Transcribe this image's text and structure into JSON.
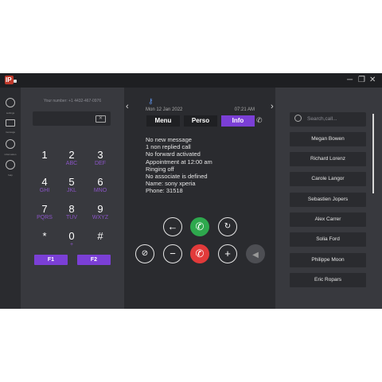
{
  "app": {
    "logo_text": "IP"
  },
  "window_controls": {
    "minimize": "─",
    "maximize": "❐",
    "close": "✕"
  },
  "sidebar": {
    "items": [
      {
        "icon": "gear-icon",
        "label": "settings"
      },
      {
        "icon": "mail-icon",
        "label": "message"
      },
      {
        "icon": "info-icon",
        "label": "information"
      },
      {
        "icon": "help-icon",
        "label": "help"
      }
    ]
  },
  "dialpad": {
    "your_number": "Your number: +1 4432-467-0976",
    "number_value": "",
    "keys": [
      {
        "digit": "1",
        "letters": ""
      },
      {
        "digit": "2",
        "letters": "ABC"
      },
      {
        "digit": "3",
        "letters": "DEF"
      },
      {
        "digit": "4",
        "letters": "GHI"
      },
      {
        "digit": "5",
        "letters": "JKL"
      },
      {
        "digit": "6",
        "letters": "MNO"
      },
      {
        "digit": "7",
        "letters": "PQRS"
      },
      {
        "digit": "8",
        "letters": "TUV"
      },
      {
        "digit": "9",
        "letters": "WXYZ"
      },
      {
        "digit": "*",
        "letters": ""
      },
      {
        "digit": "0",
        "letters": "+"
      },
      {
        "digit": "#",
        "letters": ""
      }
    ],
    "f1": "F1",
    "f2": "F2"
  },
  "center": {
    "prev_arrow": "‹",
    "next_arrow": "›",
    "date": "Mon 12 Jan 2022",
    "time": "07:21 AM",
    "tabs": {
      "menu": "Menu",
      "perso": "Perso",
      "info": "Info"
    },
    "info_lines": [
      "No new message",
      "1 non replied call",
      "No forward activated",
      "Appointment at 12:00 am",
      "Ringing off",
      "No associate is defined",
      "Name: sony xperia",
      "Phone: 31518"
    ]
  },
  "contacts": {
    "search_placeholder": "Search,call...",
    "items": [
      "Megan Bowen",
      "Richard Lorenz",
      "Carole Langor",
      "Sebastien Jopers",
      "Alex Carrer",
      "Solia Ford",
      "Philippe Moon",
      "Eric Ropars"
    ]
  },
  "colors": {
    "accent": "#7b3fd6",
    "call_green": "#2ea84d",
    "hangup_red": "#e23a3a",
    "background": "#38393e",
    "panel_dark": "#2a2b2f"
  }
}
